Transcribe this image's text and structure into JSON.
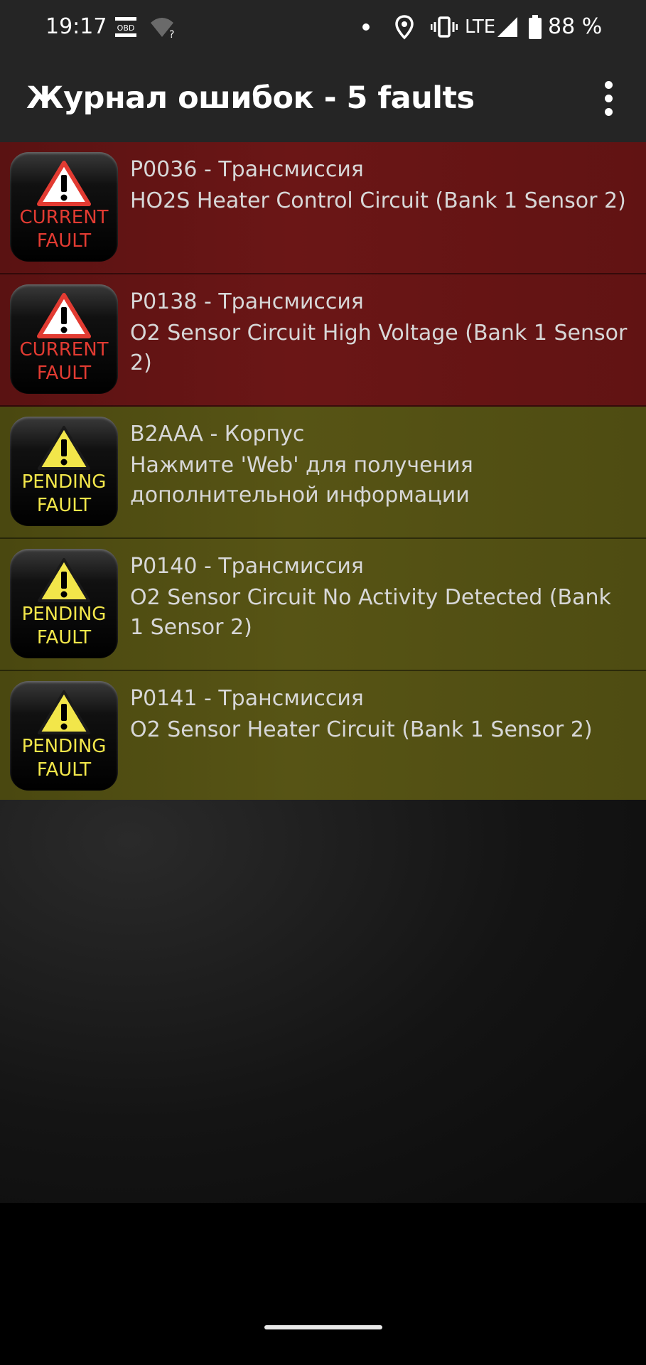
{
  "status_bar": {
    "time": "19:17",
    "network": "LTE",
    "battery": "88 %",
    "icons": [
      "obd-icon",
      "wifi-unknown-icon",
      "notification-dot-icon",
      "location-icon",
      "vibrate-icon",
      "signal-icon",
      "battery-icon"
    ]
  },
  "app_bar": {
    "title": "Журнал ошибок - 5 faults",
    "menu_icon": "more-vert-icon"
  },
  "faults": [
    {
      "status": "current",
      "badge_line1": "CURRENT",
      "badge_line2": "FAULT",
      "code": "P0036 - Трансмиссия",
      "description": "HO2S Heater Control Circuit (Bank 1 Sensor 2)"
    },
    {
      "status": "current",
      "badge_line1": "CURRENT",
      "badge_line2": "FAULT",
      "code": "P0138 - Трансмиссия",
      "description": "O2 Sensor Circuit High Voltage (Bank 1 Sensor 2)"
    },
    {
      "status": "pending",
      "badge_line1": "PENDING",
      "badge_line2": "FAULT",
      "code": "B2AAA - Корпус",
      "description": "Нажмите 'Web' для получения дополнительной информации"
    },
    {
      "status": "pending",
      "badge_line1": "PENDING",
      "badge_line2": "FAULT",
      "code": "P0140 - Трансмиссия",
      "description": "O2 Sensor Circuit No Activity Detected (Bank 1 Sensor 2)"
    },
    {
      "status": "pending",
      "badge_line1": "PENDING",
      "badge_line2": "FAULT",
      "code": "P0141 - Трансмиссия",
      "description": "O2 Sensor Heater Circuit (Bank 1 Sensor 2)"
    }
  ],
  "colors": {
    "current_row": "#6b1616",
    "pending_row": "#575415",
    "current_badge_text": "#e23b32",
    "pending_badge_text": "#f2e64a",
    "bar_background": "#252525"
  }
}
